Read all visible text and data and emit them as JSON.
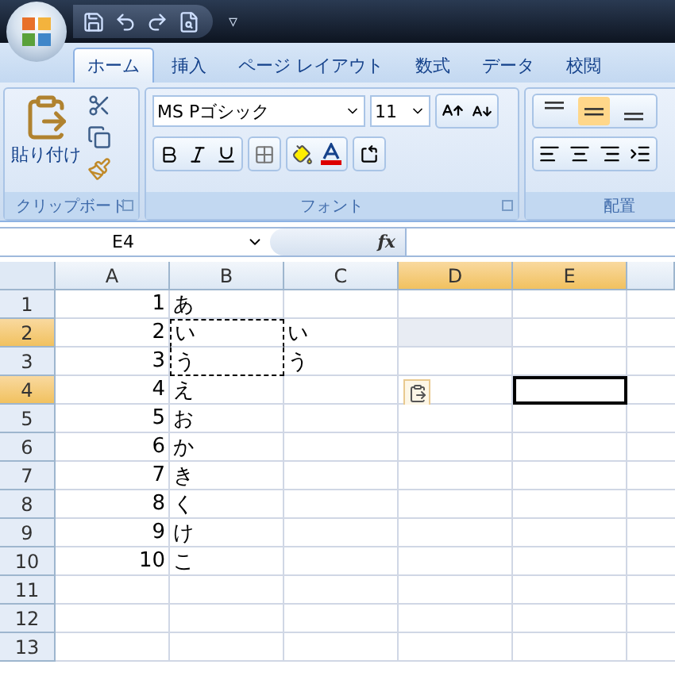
{
  "quick_access": {
    "menu_glyph": "▿"
  },
  "tabs": [
    {
      "label": "ホーム",
      "selected": true
    },
    {
      "label": "挿入",
      "selected": false
    },
    {
      "label": "ページ レイアウト",
      "selected": false
    },
    {
      "label": "数式",
      "selected": false
    },
    {
      "label": "データ",
      "selected": false
    },
    {
      "label": "校閲",
      "selected": false
    }
  ],
  "clipboard": {
    "paste_label": "貼り付け",
    "group_label": "クリップボード"
  },
  "font": {
    "font_name": "MS Pゴシック",
    "font_size": "11",
    "group_label": "フォント"
  },
  "alignment": {
    "vertical": [
      {
        "selected": false
      },
      {
        "selected": true
      },
      {
        "selected": false
      }
    ],
    "group_label": "配置"
  },
  "formula_bar": {
    "name_box": "E4",
    "function_label": "fx"
  },
  "columns": [
    {
      "label": "A",
      "selected": false
    },
    {
      "label": "B",
      "selected": false
    },
    {
      "label": "C",
      "selected": false
    },
    {
      "label": "D",
      "selected": true
    },
    {
      "label": "E",
      "selected": true
    }
  ],
  "rows": [
    {
      "header": "1",
      "selected": false,
      "cells": [
        {
          "text": "1",
          "kind": "number"
        },
        {
          "text": "あ",
          "kind": "text"
        },
        {},
        {},
        {}
      ]
    },
    {
      "header": "2",
      "selected": true,
      "cells": [
        {
          "text": "2",
          "kind": "number"
        },
        {
          "text": "い",
          "kind": "text",
          "copied": true
        },
        {
          "text": "い",
          "kind": "text"
        },
        {
          "shaded": true
        },
        {}
      ]
    },
    {
      "header": "3",
      "selected": false,
      "cells": [
        {
          "text": "3",
          "kind": "number"
        },
        {
          "text": "う",
          "kind": "text",
          "copied": true
        },
        {
          "text": "う",
          "kind": "text"
        },
        {},
        {}
      ]
    },
    {
      "header": "4",
      "selected": true,
      "cells": [
        {
          "text": "4",
          "kind": "number"
        },
        {
          "text": "え",
          "kind": "text"
        },
        {},
        {
          "paste_options": true
        },
        {
          "active": true
        }
      ]
    },
    {
      "header": "5",
      "selected": false,
      "cells": [
        {
          "text": "5",
          "kind": "number"
        },
        {
          "text": "お",
          "kind": "text"
        },
        {},
        {},
        {}
      ]
    },
    {
      "header": "6",
      "selected": false,
      "cells": [
        {
          "text": "6",
          "kind": "number"
        },
        {
          "text": "か",
          "kind": "text"
        },
        {},
        {},
        {}
      ]
    },
    {
      "header": "7",
      "selected": false,
      "cells": [
        {
          "text": "7",
          "kind": "number"
        },
        {
          "text": "き",
          "kind": "text"
        },
        {},
        {},
        {}
      ]
    },
    {
      "header": "8",
      "selected": false,
      "cells": [
        {
          "text": "8",
          "kind": "number"
        },
        {
          "text": "く",
          "kind": "text"
        },
        {},
        {},
        {}
      ]
    },
    {
      "header": "9",
      "selected": false,
      "cells": [
        {
          "text": "9",
          "kind": "number"
        },
        {
          "text": "け",
          "kind": "text"
        },
        {},
        {},
        {}
      ]
    },
    {
      "header": "10",
      "selected": false,
      "cells": [
        {
          "text": "10",
          "kind": "number"
        },
        {
          "text": "こ",
          "kind": "text"
        },
        {},
        {},
        {}
      ]
    },
    {
      "header": "11",
      "selected": false,
      "cells": [
        {},
        {},
        {},
        {},
        {}
      ]
    },
    {
      "header": "12",
      "selected": false,
      "cells": [
        {},
        {},
        {},
        {},
        {}
      ]
    },
    {
      "header": "13",
      "selected": false,
      "cells": [
        {},
        {},
        {},
        {},
        {}
      ]
    }
  ]
}
